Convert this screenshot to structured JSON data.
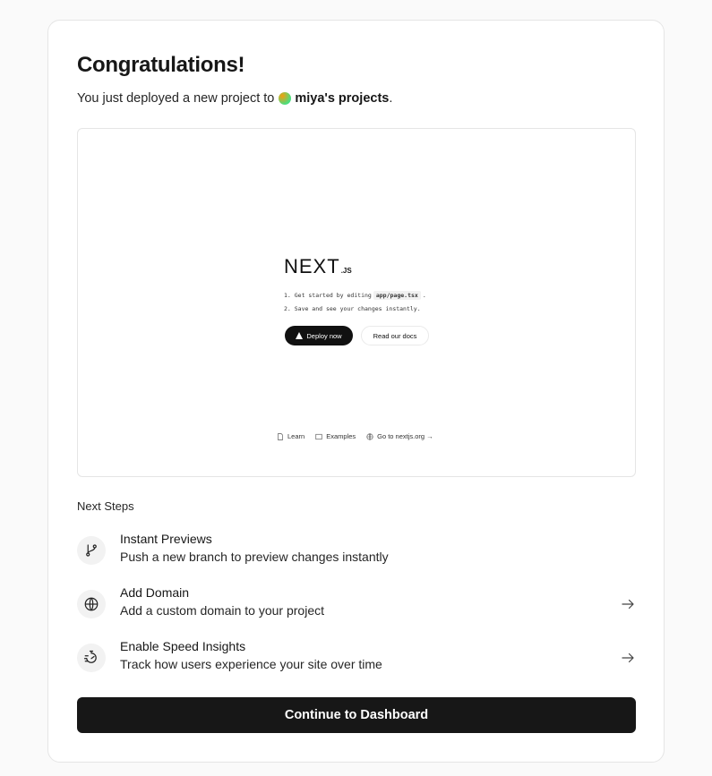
{
  "header": {
    "title": "Congratulations!",
    "subtitle_prefix": "You just deployed a new project to",
    "team_name": "miya's projects",
    "subtitle_suffix": "."
  },
  "preview": {
    "logo_word": "NEXT",
    "logo_suffix": ".JS",
    "step1_prefix": "1. Get started by editing",
    "step1_code": "app/page.tsx",
    "step1_suffix": ".",
    "step2": "2. Save and see your changes instantly.",
    "deploy_label": "Deploy now",
    "docs_label": "Read our docs",
    "footer": {
      "learn": "Learn",
      "examples": "Examples",
      "nextjs": "Go to nextjs.org →"
    }
  },
  "next_steps": {
    "heading": "Next Steps",
    "items": [
      {
        "title": "Instant Previews",
        "description": "Push a new branch to preview changes instantly",
        "icon": "git-branch-icon",
        "has_arrow": false
      },
      {
        "title": "Add Domain",
        "description": "Add a custom domain to your project",
        "icon": "globe-icon",
        "has_arrow": true
      },
      {
        "title": "Enable Speed Insights",
        "description": "Track how users experience your site over time",
        "icon": "stopwatch-icon",
        "has_arrow": true
      }
    ]
  },
  "actions": {
    "continue_label": "Continue to Dashboard"
  },
  "colors": {
    "primary_button": "#171717",
    "background": "#fafafa",
    "card": "#ffffff",
    "border": "#e5e5e5"
  }
}
